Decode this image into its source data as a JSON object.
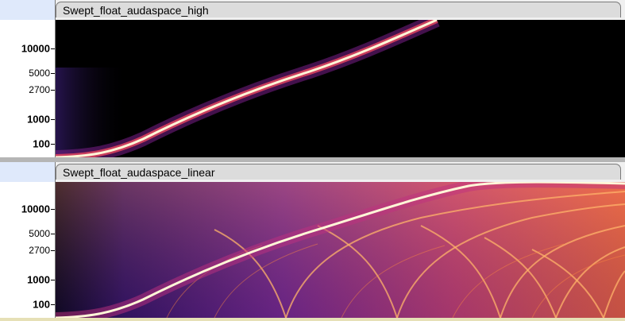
{
  "tracks": [
    {
      "name": "Swept_float_audaspace_high",
      "scale_labels": [
        "10000",
        "5000",
        "2700",
        "1000",
        "100"
      ]
    },
    {
      "name": "Swept_float_audaspace_linear",
      "scale_labels": [
        "10000",
        "5000",
        "2700",
        "1000",
        "100"
      ]
    }
  ],
  "colors": {
    "ruler_bg": "#ffffff",
    "ruler_header": "#dfe9fb",
    "tab_bg": "#dcdcdc",
    "spectrogram_low": "#000000",
    "spectrogram_mid": "#8a2fa0",
    "spectrogram_high": "#ff9a3c",
    "spectrogram_peak": "#ffffff"
  }
}
